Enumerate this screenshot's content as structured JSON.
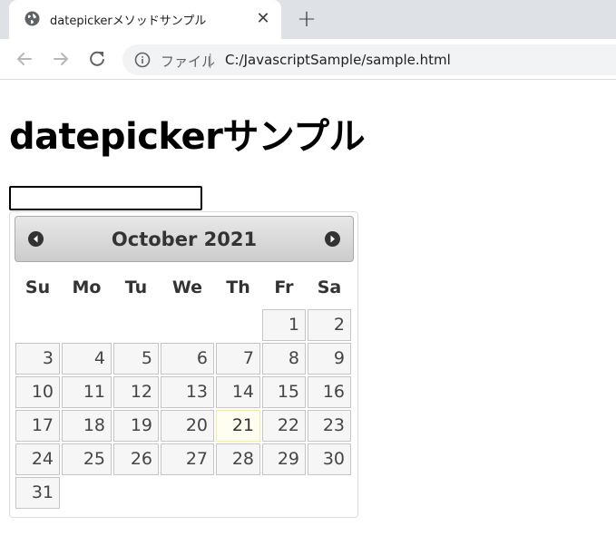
{
  "browser": {
    "tab_title": "datepickerメソッドサンプル",
    "close_glyph": "✕",
    "new_tab_glyph": "+",
    "address": {
      "scheme_label": "ファイル",
      "separator": "|",
      "url": "C:/JavascriptSample/sample.html"
    }
  },
  "page": {
    "heading": "datepickerサンプル",
    "date_input_value": ""
  },
  "datepicker": {
    "month": "October",
    "year": "2021",
    "title": "October 2021",
    "weekdays": [
      "Su",
      "Mo",
      "Tu",
      "We",
      "Th",
      "Fr",
      "Sa"
    ],
    "today": "21",
    "weeks": [
      [
        "",
        "",
        "",
        "",
        "",
        "1",
        "2"
      ],
      [
        "3",
        "4",
        "5",
        "6",
        "7",
        "8",
        "9"
      ],
      [
        "10",
        "11",
        "12",
        "13",
        "14",
        "15",
        "16"
      ],
      [
        "17",
        "18",
        "19",
        "20",
        "21",
        "22",
        "23"
      ],
      [
        "24",
        "25",
        "26",
        "27",
        "28",
        "29",
        "30"
      ],
      [
        "31",
        "",
        "",
        "",
        "",
        "",
        ""
      ]
    ],
    "colors": {
      "header_border": "#aaaaaa",
      "cell_background": "#f6f6f6",
      "cell_border": "#c5c5c5",
      "text": "#454545",
      "today_background": "#fffef0"
    }
  }
}
